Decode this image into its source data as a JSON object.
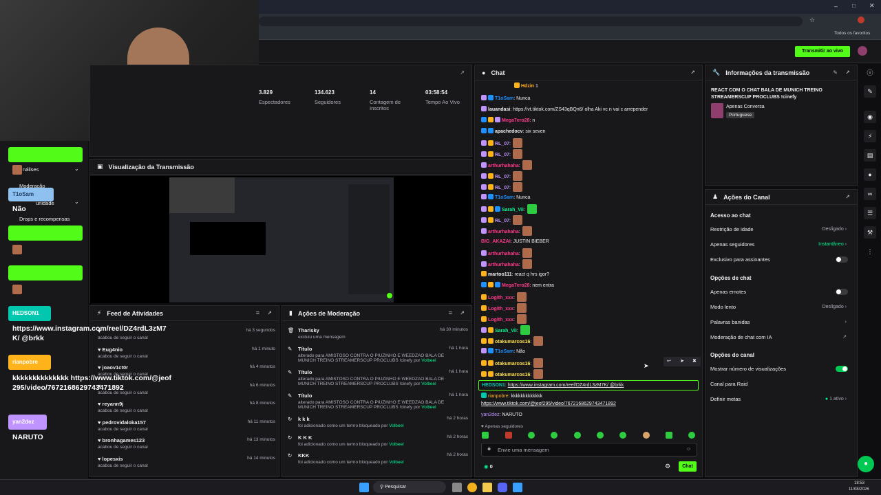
{
  "app": {
    "live_button": "Transmitir ao vivo",
    "bookmarks": "Todos os favoritos"
  },
  "stats": [
    {
      "value": "3.829",
      "label": "Espectadores"
    },
    {
      "value": "134.623",
      "label": "Seguidores"
    },
    {
      "value": "14",
      "label": "Contagem de Inscritos"
    },
    {
      "value": "03:58:54",
      "label": "Tempo Ao Vivo"
    }
  ],
  "preview": {
    "title": "Visualização da Transmissão"
  },
  "chat": {
    "title": "Chat",
    "pinned": "Hdzin",
    "pinned_count": "1",
    "messages": [
      {
        "user": "T1oSam",
        "text": ": Nunca",
        "color": "#1e90ff"
      },
      {
        "user": "lauandasi",
        "text": ": https://vt.tiktok.com/ZS43qBQn6/ olha Aki vc n vai c arrepender",
        "color": "#efeff1"
      },
      {
        "user": "Mega7ero28",
        "text": ": n",
        "color": "#ff3b8d"
      },
      {
        "user": "apachedocv",
        "text": ": six seven",
        "color": "#efeff1"
      },
      {
        "user": "RL_07",
        "text": ":",
        "color": "#bf94ff"
      },
      {
        "user": "RL_07",
        "text": ":",
        "color": "#bf94ff"
      },
      {
        "user": "arthurhahaha",
        "text": ":",
        "color": "#ff3b8d"
      },
      {
        "user": "RL_07",
        "text": ":",
        "color": "#bf94ff"
      },
      {
        "user": "RL_07",
        "text": ":",
        "color": "#bf94ff"
      },
      {
        "user": "T1oSam",
        "text": ": Nunca",
        "color": "#1e90ff"
      },
      {
        "user": "Sarah_Vii",
        "text": ":",
        "color": "#00f593"
      },
      {
        "user": "RL_07",
        "text": ":",
        "color": "#bf94ff"
      },
      {
        "user": "arthurhahaha",
        "text": ":",
        "color": "#ff3b8d"
      },
      {
        "user": "BIG_AKAZAI",
        "text": ": JUSTIN BIEBER",
        "color": "#ff3b8d"
      },
      {
        "user": "arthurhahaha",
        "text": ":",
        "color": "#ff3b8d"
      },
      {
        "user": "arthurhahaha",
        "text": ":",
        "color": "#ff3b8d"
      },
      {
        "user": "martoo111",
        "text": ": react q hrs igor?",
        "color": "#efeff1"
      },
      {
        "user": "Mega7ero28",
        "text": ": nem entra",
        "color": "#ff3b8d"
      },
      {
        "user": "Logith_xxx",
        "text": ":",
        "color": "#ff3b8d"
      },
      {
        "user": "Logith_xxx",
        "text": ":",
        "color": "#ff3b8d"
      },
      {
        "user": "Logith_xxx",
        "text": ":",
        "color": "#ff3b8d"
      },
      {
        "user": "Sarah_Vii",
        "text": ":",
        "color": "#00f593"
      },
      {
        "user": "otakumarcos16",
        "text": ":",
        "color": "#ffe14d"
      },
      {
        "user": "T1oSam",
        "text": ": Não",
        "color": "#1e90ff"
      },
      {
        "user": "otakumarcos16",
        "text": ":",
        "color": "#ffe14d"
      },
      {
        "user": "otakumarcos16",
        "text": ":",
        "color": "#ffe14d"
      }
    ],
    "highlight": {
      "user": "HEDSON1",
      "text": "https://www.instagram.com/reel/DZ4rdL3zM7K/ @brkk"
    },
    "rianpobre": {
      "user": "rianpobre",
      "text": ": kkkkkkkkkkkkk",
      "link": "https://www.tiktok.com/@jeof295/video/7672168629743471892"
    },
    "yan": {
      "user": "yan2dez",
      "text": ": NARUTO"
    },
    "followers_only": "Apenas seguidores",
    "placeholder": "Envie uma mensagem",
    "count": "0",
    "send": "Chat"
  },
  "info": {
    "title": "Informações da transmissão",
    "stream_title": "REACT COM O CHAT BALA DE MUNICH TREINO STREAMERSCUP PROCLUBS !cinefy",
    "category": "Apenas Conversa",
    "language": "Portuguese"
  },
  "actions": {
    "title": "Ações do Canal",
    "chat_access": "Acesso ao chat",
    "age": "Restrição de idade",
    "age_v": "Desligado",
    "followers": "Apenas seguidores",
    "followers_v": "Instantâneo",
    "subs": "Exclusivo para assinantes",
    "chat_opts": "Opções de chat",
    "emotes": "Apenas emotes",
    "slow": "Modo lento",
    "slow_v": "Desligado",
    "banned": "Palavras banidas",
    "ai": "Moderação de chat com IA",
    "channel_opts": "Opções do canal",
    "views": "Mostrar número de visualizações",
    "raid": "Canal para Raid",
    "goals": "Definir metas",
    "goals_v": "1 ativo"
  },
  "feed": {
    "title": "Feed de Atividades",
    "rows": [
      {
        "user": "",
        "sub": "acabou de seguir o canal",
        "time": "há 3 segundos"
      },
      {
        "user": "Eug4nio",
        "sub": "acabou de seguir o canal",
        "time": "há 1 minuto"
      },
      {
        "user": "joaov1ct0r",
        "sub": "acabou de seguir o canal",
        "time": "há 4 minutos"
      },
      {
        "user": "",
        "sub": "acabou de seguir o canal",
        "time": "há 6 minutos"
      },
      {
        "user": "reyann9j",
        "sub": "acabou de seguir o canal",
        "time": "há 8 minutos"
      },
      {
        "user": "pedrovidaloka157",
        "sub": "acabou de seguir o canal",
        "time": "há 11 minutos"
      },
      {
        "user": "bronhagames123",
        "sub": "acabou de seguir o canal",
        "time": "há 13 minutos"
      },
      {
        "user": "lopesxis",
        "sub": "acabou de seguir o canal",
        "time": "há 14 minutos"
      }
    ]
  },
  "mod": {
    "title": "Ações de Moderação",
    "rows": [
      {
        "title": "Tharisky",
        "sub": "excluiu uma mensagem",
        "by": "",
        "time": "há 30 minutos"
      },
      {
        "title": "Título",
        "sub": "alterado para AMISTOSO CONTRA O PIUZINHO E WEEDZAO BALA DE MUNICH TREINO STREAMERSCUP PROCLUBS !cinefy por",
        "by": "Volbeel",
        "time": "há 1 hora"
      },
      {
        "title": "Título",
        "sub": "alterado para AMISTOSO CONTRA O PIUZINHO E WEEDZAO BALA DE MUNICH TREINO STREAMERSCUP PROCLUBS !cinefy por",
        "by": "Volbeel",
        "time": "há 1 hora"
      },
      {
        "title": "Título",
        "sub": "alterado para AMISTOSO CONTRA O PIUZINHO E WEEDZAO BALA DE MUNICH TREINO STREAMERSCUP PROCLUBS !cinefy por",
        "by": "Volbeel",
        "time": "há 1 hora"
      },
      {
        "title": "k k k",
        "sub": "foi adicionado como um termo bloqueado por",
        "by": "Volbeel",
        "time": "há 2 horas"
      },
      {
        "title": "K K K",
        "sub": "foi adicionado como um termo bloqueado por",
        "by": "Volbeel",
        "time": "há 2 horas"
      },
      {
        "title": "KKK",
        "sub": "foi adicionado como um termo bloqueado por",
        "by": "Volbeel",
        "time": "há 2 horas"
      }
    ]
  },
  "sidebar": {
    "analises": "nálises",
    "moderacao": "Moderação",
    "comunidade": "unidade",
    "drops": "Drops e recompensas"
  },
  "overlay": [
    {
      "user": "otakumarcos16",
      "msg": ""
    },
    {
      "user": "T1oSam",
      "msg": "Não"
    },
    {
      "user": "otakumarcos16",
      "msg": ""
    },
    {
      "user": "otakumarcos16",
      "msg": ""
    },
    {
      "user": "HEDSON1",
      "msg": "https://www.instagram.com/reel/DZ4rdL3zM7K/ @brkk"
    },
    {
      "user": "rianpobre",
      "msg": "kkkkkkkkkkkkkk https://www.tiktok.com/@jeof295/video/7672168629743471892"
    },
    {
      "user": "yan2dez",
      "msg": "NARUTO"
    }
  ],
  "taskbar": {
    "search": "Pesquisar",
    "time": "18:53",
    "date": "11/08/2026"
  },
  "colors": {
    "accent": "#53fc18",
    "bg": "#0e0e10",
    "panel": "#18181b"
  }
}
